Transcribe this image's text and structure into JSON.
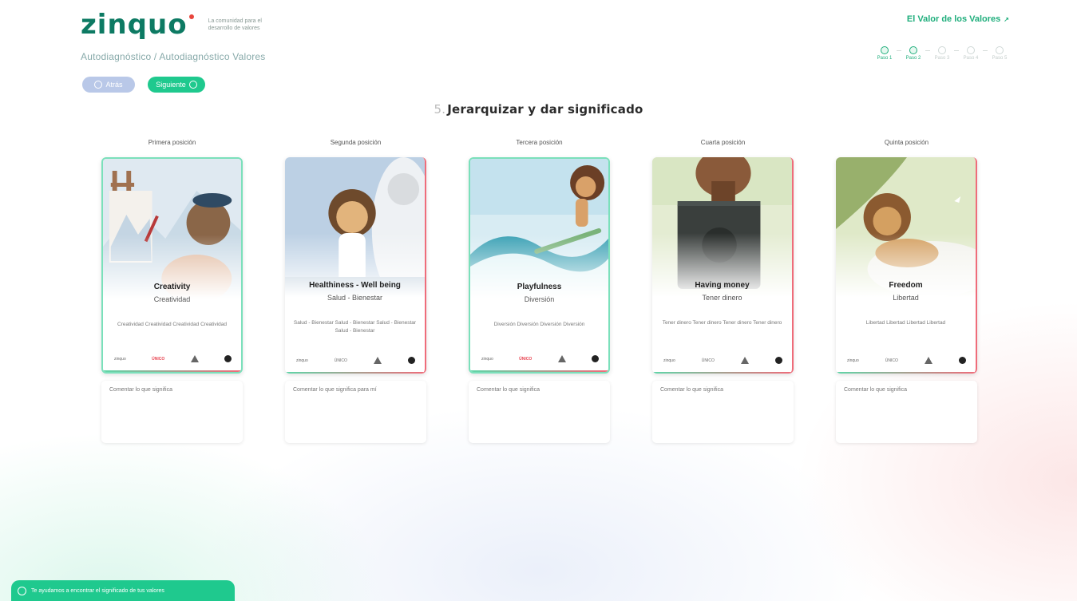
{
  "header": {
    "logo": "zinquo",
    "tagline": "La comunidad para el desarrollo de valores",
    "values_link": "El Valor de los Valores",
    "breadcrumb": "Autodiagnóstico / Autodiagnóstico Valores"
  },
  "buttons": {
    "back": "Atrás",
    "next": "Siguiente"
  },
  "steps": [
    {
      "label": "Paso 1",
      "done": true
    },
    {
      "label": "Paso 2",
      "done": true
    },
    {
      "label": "Paso 3",
      "done": false
    },
    {
      "label": "Paso 4",
      "done": false
    },
    {
      "label": "Paso 5",
      "done": false
    }
  ],
  "page_title": {
    "prefix": "5.",
    "title": "Jerarquizar y dar significado"
  },
  "cards": [
    {
      "position": "Primera posición",
      "title": "Creativity",
      "subtitle": "Creatividad",
      "desc": "Creatividad   Creatividad Creatividad   Creatividad",
      "note_placeholder": "Comentar lo que significa",
      "icons": [
        "zinquo",
        "ÚNICO",
        "▲",
        "●"
      ]
    },
    {
      "position": "Segunda posición",
      "title": "Healthiness - Well being",
      "subtitle": "Salud - Bienestar",
      "desc": "Salud - Bienestar   Salud - Bienestar Salud - Bienestar   Salud - Bienestar",
      "note_placeholder": "Comentar lo que significa para mí",
      "icons": [
        "zinquo",
        "ÚNICO",
        "▲",
        "●"
      ]
    },
    {
      "position": "Tercera posición",
      "title": "Playfulness",
      "subtitle": "Diversión",
      "desc": "Diversión   Diversión Diversión   Diversión",
      "note_placeholder": "Comentar lo que significa",
      "icons": [
        "zinquo",
        "ÚNICO",
        "▲",
        "●"
      ]
    },
    {
      "position": "Cuarta posición",
      "title": "Having money",
      "subtitle": "Tener dinero",
      "desc": "Tener dinero   Tener dinero Tener dinero   Tener dinero",
      "note_placeholder": "Comentar lo que significa",
      "icons": [
        "zinquo",
        "ÚNICO",
        "▲",
        "●"
      ]
    },
    {
      "position": "Quinta posición",
      "title": "Freedom",
      "subtitle": "Libertad",
      "desc": "Libertad   Libertad Libertad   Libertad",
      "note_placeholder": "Comentar lo que significa",
      "icons": [
        "zinquo",
        "ÚNICO",
        "▲",
        "●"
      ]
    }
  ],
  "chat": {
    "label": "Te ayudamos a encontrar el significado de tus valores"
  },
  "colors": {
    "brand": "#0d7a63",
    "accent": "#1fc98e",
    "back_button": "#b9c8e8",
    "red_accent": "#ef6c7a"
  }
}
